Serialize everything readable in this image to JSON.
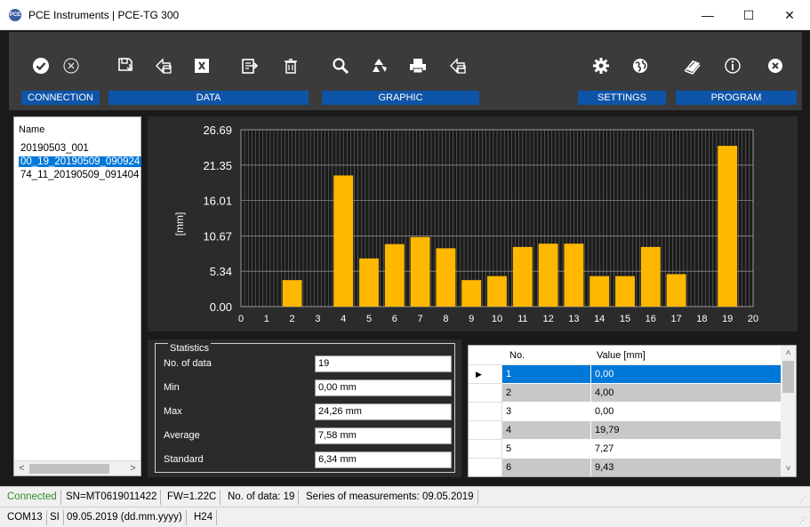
{
  "window": {
    "title": "PCE Instruments | PCE-TG 300",
    "icon_text": "PCE",
    "minimize": "—",
    "maximize": "☐",
    "close": "✕"
  },
  "toolbar": {
    "groups": [
      "CONNECTION",
      "DATA",
      "GRAPHIC",
      "SETTINGS",
      "PROGRAM"
    ],
    "buttons": [
      "connect-icon",
      "disconnect-icon",
      "save-data-icon",
      "export-data-icon",
      "export-excel-icon",
      "import-data-icon",
      "delete-icon",
      "zoom-icon",
      "refresh-icon",
      "print-icon",
      "export-graphic-icon",
      "settings-icon",
      "language-icon",
      "manual-icon",
      "info-icon",
      "exit-icon"
    ]
  },
  "file_list": {
    "header": "Name",
    "items": [
      "20190503_001",
      "00_19_20190509_090924",
      "74_11_20190509_091404"
    ],
    "selected_index": 1
  },
  "chart_data": {
    "type": "bar",
    "ylabel": "[mm]",
    "ylim": [
      0,
      26.69
    ],
    "yticks": [
      "0.00",
      "5.34",
      "10.67",
      "16.01",
      "21.35",
      "26.69"
    ],
    "xticks": [
      "0",
      "1",
      "2",
      "3",
      "4",
      "5",
      "6",
      "7",
      "8",
      "9",
      "10",
      "11",
      "12",
      "13",
      "14",
      "15",
      "16",
      "17",
      "18",
      "19",
      "20"
    ],
    "categories": [
      1,
      2,
      3,
      4,
      5,
      6,
      7,
      8,
      9,
      10,
      11,
      12,
      13,
      14,
      15,
      16,
      17,
      18,
      19
    ],
    "values": [
      0,
      4.0,
      0,
      19.79,
      7.27,
      9.43,
      10.5,
      8.8,
      4.0,
      4.6,
      9.0,
      9.5,
      9.5,
      4.6,
      4.6,
      9.0,
      4.9,
      0,
      24.26
    ],
    "bar_color": "#ffb800",
    "background": "#1b1b1b",
    "grid": true
  },
  "statistics": {
    "title": "Statistics",
    "rows": [
      {
        "label": "No. of data",
        "value": "19"
      },
      {
        "label": "Min",
        "value": "0,00 mm"
      },
      {
        "label": "Max",
        "value": "24,26 mm"
      },
      {
        "label": "Average",
        "value": "7,58 mm"
      },
      {
        "label": "Standard",
        "value": "6,34 mm"
      }
    ]
  },
  "table": {
    "columns": [
      "No.",
      "Value [mm]"
    ],
    "rows": [
      [
        "1",
        "0,00"
      ],
      [
        "2",
        "4,00"
      ],
      [
        "3",
        "0,00"
      ],
      [
        "4",
        "19,79"
      ],
      [
        "5",
        "7,27"
      ],
      [
        "6",
        "9,43"
      ]
    ],
    "selected_index": 0,
    "current_marker": "▶"
  },
  "status_bar": {
    "connection": "Connected",
    "serial": "SN=MT0619011422",
    "firmware": "FW=1.22C",
    "count": "No. of data: 19",
    "series": "Series of measurements: 09.05.2019"
  },
  "status_bar2": {
    "port": "COM13",
    "units": "SI",
    "date": "09.05.2019 (dd.mm.yyyy)",
    "time_format": "H24"
  },
  "colors": {
    "accent": "#0e54a8",
    "bar": "#ffb800",
    "connected": "#2e8b2e",
    "selection": "#0078d7"
  }
}
